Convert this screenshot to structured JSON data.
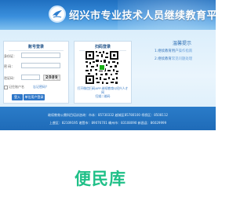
{
  "header": {
    "site_title": "绍兴市专业技术人员继续教育平台",
    "logo_icon": "bird-emblem-icon"
  },
  "login": {
    "title": "账号登录",
    "id_label": "身份证：",
    "password_label": "密 码：",
    "captcha_label": "验证码：",
    "captcha_code": "2089",
    "remember_label": "记住账户名",
    "forgot_label": "忘记密码？",
    "login_button": "登入",
    "user_center_button": "单位用户登录"
  },
  "qr": {
    "title": "扫码登录",
    "caption_line1": "打开微信扫码APP-继续教育Q绍兴人才网",
    "caption_line2": "扫描二维码"
  },
  "notices": {
    "title": "温馨提示",
    "items": [
      {
        "prefix": "1.继续教育用户",
        "highlight": "操作指南"
      },
      {
        "prefix": "2.继续教育",
        "highlight": "常见问题处理"
      }
    ]
  },
  "footer": {
    "line1": "继续教育公需科目培训咨询：市本：85730332  越城区85780100  柯桥区：8508112",
    "line2": "上虞区：82109195  诸暨市：89076701  嵊州市：83108090  新昌县：86029999"
  },
  "brand": {
    "name": "便民库"
  },
  "colors": {
    "banner": "#2f7fd0",
    "footer": "#2172bd",
    "brand_green": "#20c088",
    "button_blue": "#2f77c8"
  }
}
